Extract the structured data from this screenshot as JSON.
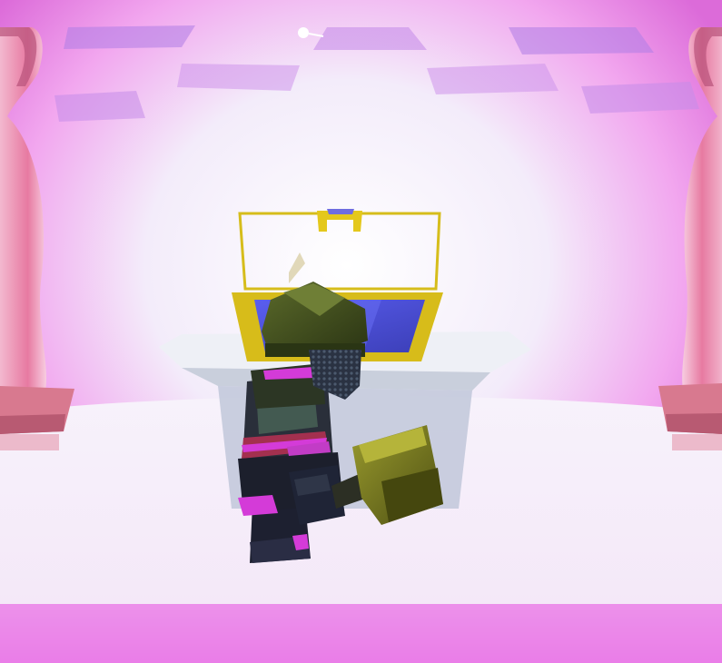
{
  "scene": {
    "kind": "3d-game-viewport",
    "hud_text": [],
    "palette": {
      "glow_white": "#f6f0fb",
      "magenta": "#e86fe6",
      "violet": "#b27fe8",
      "pillar_pink": "#e87aa0",
      "pillar_base": "#c9687e",
      "chest_gold": "#d9c01a",
      "chest_inner_blue": "#4b4fd8",
      "knight_armor_dark": "#1f2230",
      "knight_helmet_olive": "#3d4a1e",
      "knight_trim_magenta": "#d43bd8",
      "hammer_olive": "#7d7f22"
    },
    "objects": [
      {
        "name": "left-statue-pillar",
        "type": "pillar-icon"
      },
      {
        "name": "right-statue-pillar",
        "type": "pillar-icon"
      },
      {
        "name": "treasure-chest",
        "type": "open-chest-icon",
        "state": "open"
      },
      {
        "name": "player-knight",
        "type": "knight-icon"
      },
      {
        "name": "war-hammer",
        "type": "hammer-icon"
      }
    ]
  }
}
